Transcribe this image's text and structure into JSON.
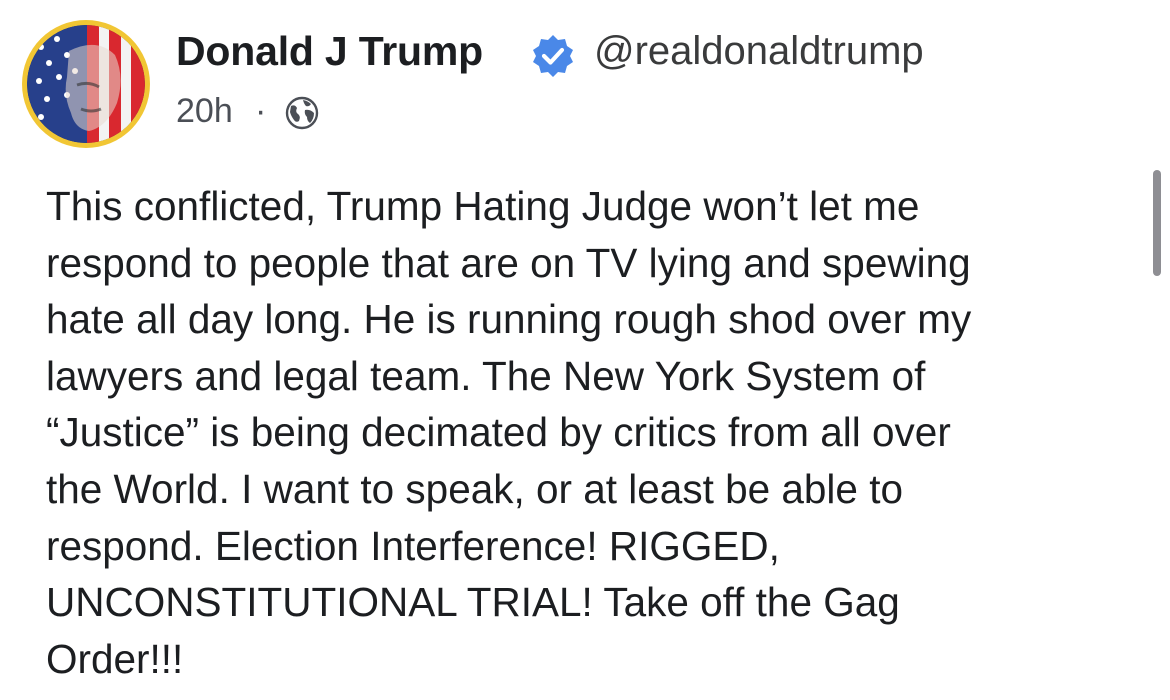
{
  "post": {
    "author_name": "Donald J Trump",
    "handle": "@realdonaldtrump",
    "time": "20h",
    "separator": "·",
    "audience_icon": "globe-icon",
    "verified_icon": "verified-badge-icon",
    "body_lines": [
      "This conflicted, Trump Hating Judge won’t let me",
      "respond to people that are on TV lying and spewing",
      "hate all day long. He is running rough shod over my",
      "lawyers and legal team. The New York System of",
      "“Justice” is being decimated by critics from all over",
      "the World. I want to speak, or at least be able to",
      "respond. Election Interference! RIGGED,",
      "UNCONSTITUTIONAL TRIAL! Take off the Gag",
      "Order!!!"
    ]
  },
  "colors": {
    "avatar_ring": "#f1c634",
    "verified_badge": "#4a88e8",
    "text_primary": "#1c1e21",
    "text_secondary": "#4b4f56",
    "scrollbar": "#8e8e93"
  }
}
